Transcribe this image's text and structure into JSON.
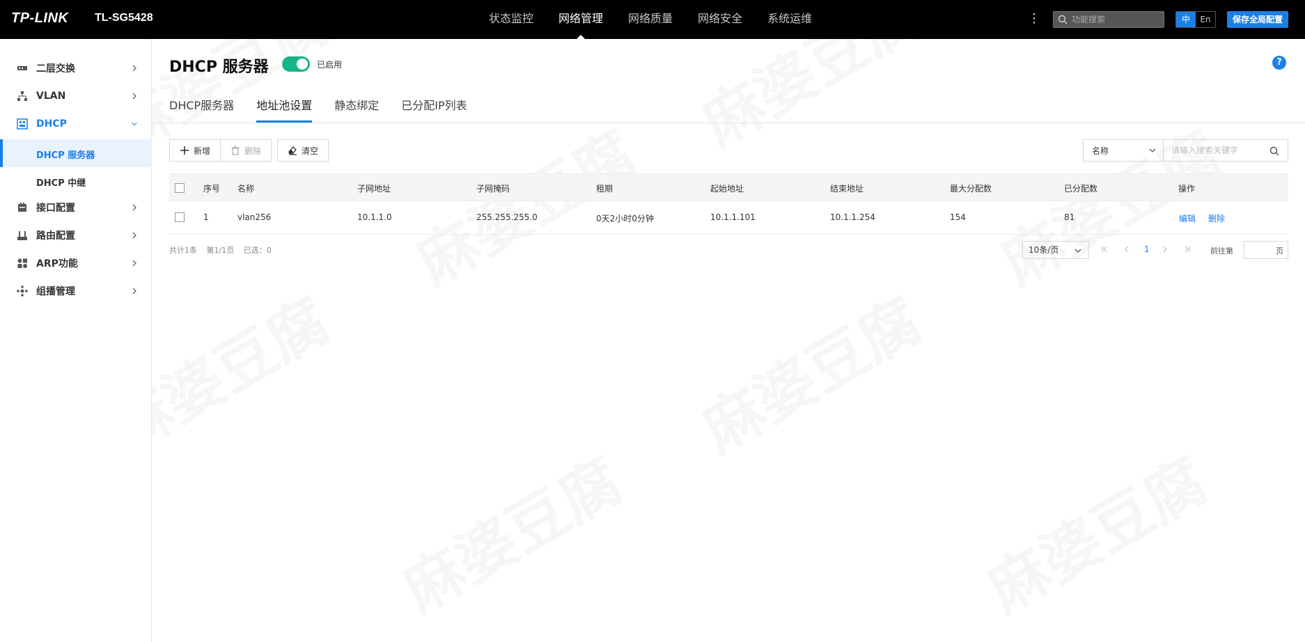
{
  "header": {
    "brand": "TP-LINK",
    "model": "TL-SG5428",
    "nav": [
      {
        "label": "状态监控"
      },
      {
        "label": "网络管理"
      },
      {
        "label": "网络质量"
      },
      {
        "label": "网络安全"
      },
      {
        "label": "系统运维"
      }
    ],
    "active_nav": "网络管理",
    "search_placeholder": "功能搜索",
    "lang_zh": "中",
    "lang_en": "En",
    "save_label": "保存全局配置"
  },
  "sidebar": {
    "items": [
      {
        "label": "二层交换",
        "icon": "switch-icon"
      },
      {
        "label": "VLAN",
        "icon": "vlan-icon"
      },
      {
        "label": "DHCP",
        "icon": "dhcp-icon"
      },
      {
        "label": "接口配置",
        "icon": "interface-icon"
      },
      {
        "label": "路由配置",
        "icon": "route-icon"
      },
      {
        "label": "ARP功能",
        "icon": "arp-icon"
      },
      {
        "label": "组播管理",
        "icon": "multicast-icon"
      }
    ],
    "subitems": [
      {
        "label": "DHCP 服务器"
      },
      {
        "label": "DHCP 中继"
      }
    ]
  },
  "page": {
    "title": "DHCP 服务器",
    "toggle_label": "已启用",
    "toggle_on": true,
    "help": "?"
  },
  "tabs": [
    {
      "label": "DHCP服务器"
    },
    {
      "label": "地址池设置"
    },
    {
      "label": "静态绑定"
    },
    {
      "label": "已分配IP列表"
    }
  ],
  "toolbar": {
    "add": "新增",
    "delete": "删除",
    "clear": "清空",
    "filter_value": "名称",
    "search_placeholder": "请输入搜索关键字"
  },
  "table": {
    "columns": [
      "序号",
      "名称",
      "子网地址",
      "子网掩码",
      "租期",
      "起始地址",
      "结束地址",
      "最大分配数",
      "已分配数",
      "操作"
    ],
    "rows": [
      {
        "index": "1",
        "name": "vlan256",
        "subnet": "10.1.1.0",
        "mask": "255.255.255.0",
        "lease": "0天2小时0分钟",
        "start": "10.1.1.101",
        "end": "10.1.1.254",
        "max": "154",
        "assigned": "81",
        "edit": "编辑",
        "delete": "删除"
      }
    ]
  },
  "footer": {
    "total": "共计1条",
    "page": "第1/1页",
    "selected": "已选：0",
    "page_size": "10条/页",
    "current_page": "1",
    "goto_label": "前往第",
    "goto_suffix": "页"
  },
  "watermark": "麻婆豆腐",
  "colors": {
    "accent": "#1b7fe8",
    "toggle": "#17b489",
    "topbar": "#000000"
  }
}
